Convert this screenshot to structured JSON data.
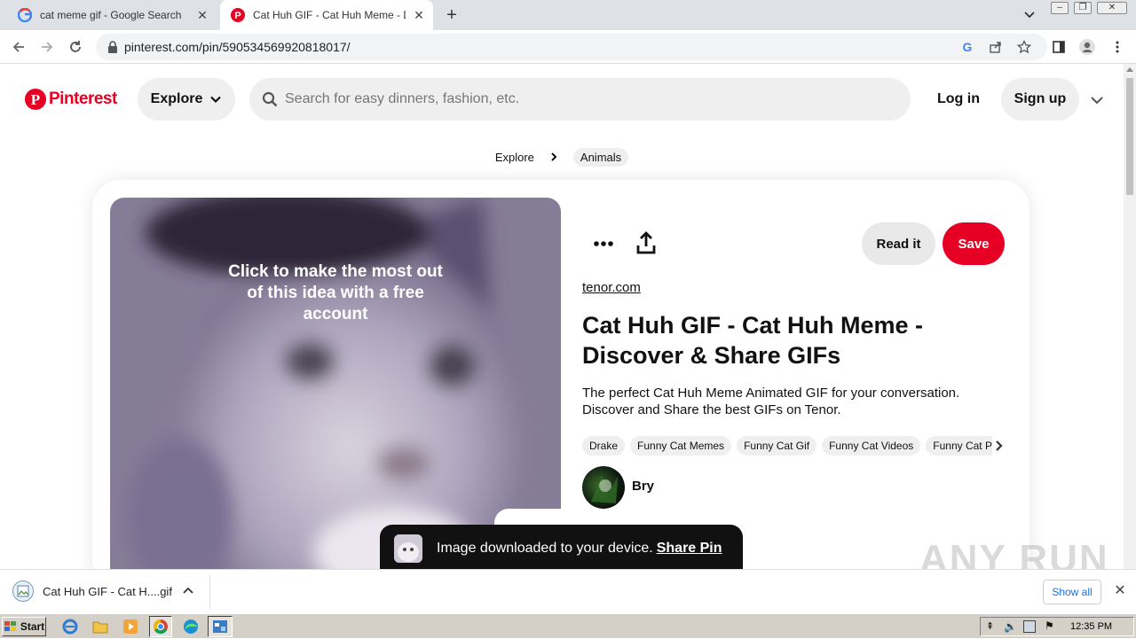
{
  "browser": {
    "tabs": [
      {
        "title": "cat meme gif - Google Search",
        "active": false
      },
      {
        "title": "Cat Huh GIF - Cat Huh Meme - Disco",
        "active": true
      }
    ],
    "url": "pinterest.com/pin/590534569920818017/"
  },
  "header": {
    "logo_text": "Pinterest",
    "explore_label": "Explore",
    "search_placeholder": "Search for easy dinners, fashion, etc.",
    "login_label": "Log in",
    "signup_label": "Sign up"
  },
  "breadcrumb": {
    "explore": "Explore",
    "category": "Animals"
  },
  "pin": {
    "image_caption": "Click to make the most out of this idea with a free account",
    "read_it_label": "Read it",
    "save_label": "Save",
    "source": "tenor.com",
    "title": "Cat Huh GIF - Cat Huh Meme - Discover & Share GIFs",
    "description": "The perfect Cat Huh Meme Animated GIF for your conversation. Discover and Share the best GIFs on Tenor.",
    "tags": [
      "Drake",
      "Funny Cat Memes",
      "Funny Cat Gif",
      "Funny Cat Videos",
      "Funny Cat Pictures"
    ],
    "author": "Bry"
  },
  "toast": {
    "message": "Image downloaded to your device.",
    "link": "Share Pin"
  },
  "watermark": "ANY RUN",
  "download_bar": {
    "filename": "Cat Huh GIF - Cat H....gif",
    "show_all_label": "Show all"
  },
  "taskbar": {
    "start_label": "Start",
    "clock": "12:35 PM"
  },
  "colors": {
    "pinterest_red": "#e60023",
    "chip_gray": "#efefef"
  }
}
